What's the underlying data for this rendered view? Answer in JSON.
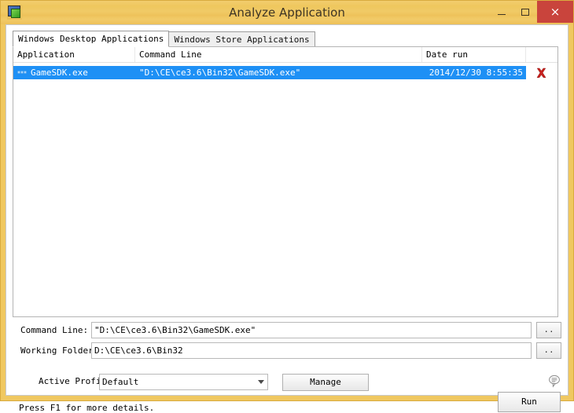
{
  "window": {
    "title": "Analyze Application",
    "icon": "monitor-app-icon",
    "frame_color": "#efc75e",
    "close_color": "#c9443c",
    "controls": {
      "minimize": "minimize-icon",
      "maximize": "maximize-icon",
      "close": "×"
    }
  },
  "tabs": [
    {
      "label": "Windows Desktop Applications",
      "active": true
    },
    {
      "label": "Windows Store Applications",
      "active": false
    }
  ],
  "list": {
    "columns": [
      {
        "label": "Application"
      },
      {
        "label": "Command Line"
      },
      {
        "label": "Date run"
      },
      {
        "label": ""
      }
    ],
    "rows": [
      {
        "icon": "app-icon",
        "application": "GameSDK.exe",
        "command_line": "\"D:\\CE\\ce3.6\\Bin32\\GameSDK.exe\"",
        "date_run": "2014/12/30 8:55:35",
        "delete": "delete-icon",
        "selected": true,
        "selection_color": "#1e90f5"
      }
    ]
  },
  "fields": {
    "command_line": {
      "label": "Command Line:",
      "value": "\"D:\\CE\\ce3.6\\Bin32\\GameSDK.exe\"",
      "browse_label": ".."
    },
    "working_folder": {
      "label": "Working Folder",
      "value": "D:\\CE\\ce3.6\\Bin32",
      "browse_label": ".."
    }
  },
  "profile": {
    "label": "Active Profil",
    "selected": "Default",
    "options": [
      "Default"
    ],
    "manage_label": "Manage"
  },
  "footer": {
    "status": "Press F1 for more details.",
    "run_label": "Run",
    "comment_icon": "speech-bubble-icon"
  }
}
